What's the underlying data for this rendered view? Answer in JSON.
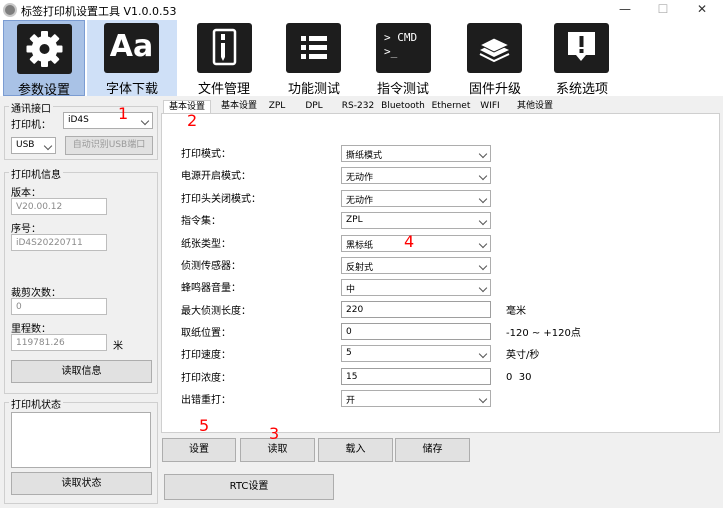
{
  "window": {
    "title": "标签打印机设置工具  V1.0.0.53",
    "minimize": "—",
    "maximize": "☐",
    "close": "✕"
  },
  "toolbar": [
    {
      "label": "参数设置",
      "icon": "gear-icon"
    },
    {
      "label": "字体下载",
      "icon": "font-aa-icon",
      "glyph": "Aa"
    },
    {
      "label": "文件管理",
      "icon": "file-manager-icon"
    },
    {
      "label": "功能测试",
      "icon": "list-icon"
    },
    {
      "label": "指令测试",
      "icon": "cmd-terminal-icon",
      "glyph_line1": "> CMD",
      "glyph_line2": ">_"
    },
    {
      "label": "固件升级",
      "icon": "chip-stack-icon"
    },
    {
      "label": "系统选项",
      "icon": "alert-box-icon"
    }
  ],
  "comm": {
    "group_label": "通讯接口",
    "printer_label": "打印机：",
    "printer_value": "iD4S",
    "port_value": "USB",
    "auto_detect_button": "自动识别USB端口"
  },
  "info": {
    "group_label": "打印机信息",
    "version_label": "版本：",
    "version_value": "V20.00.12",
    "serial_label": "序号：",
    "serial_value": "iD4S20220711",
    "cut_label": "裁剪次数：",
    "cut_value": "0",
    "mileage_label": "里程数：",
    "mileage_value": "119781.26",
    "mileage_unit": "米",
    "read_info_button": "读取信息"
  },
  "status": {
    "group_label": "打印机状态",
    "read_status_button": "读取状态"
  },
  "tabs": [
    "基本设置",
    "基本设置",
    "ZPL",
    "DPL",
    "RS-232",
    "Bluetooth",
    "Ethernet",
    "WIFI",
    "其他设置"
  ],
  "settings": [
    {
      "label": "打印模式：",
      "value": "撕纸模式",
      "kind": "combo"
    },
    {
      "label": "电源开启模式：",
      "value": "无动作",
      "kind": "combo"
    },
    {
      "label": "打印头关闭模式：",
      "value": "无动作",
      "kind": "combo"
    },
    {
      "label": "指令集：",
      "value": "ZPL",
      "kind": "combo"
    },
    {
      "label": "纸张类型：",
      "value": "黑标纸",
      "kind": "combo"
    },
    {
      "label": "侦测传感器：",
      "value": "反射式",
      "kind": "combo"
    },
    {
      "label": "蜂鸣器音量：",
      "value": "中",
      "kind": "combo"
    },
    {
      "label": "最大侦测长度：",
      "value": "220",
      "kind": "input",
      "unit": "毫米"
    },
    {
      "label": "取纸位置：",
      "value": "0",
      "kind": "input",
      "unit": "-120 ~ +120点"
    },
    {
      "label": "打印速度：",
      "value": "5",
      "kind": "combo",
      "unit": "英寸/秒"
    },
    {
      "label": "打印浓度：",
      "value": "15",
      "kind": "input",
      "unit": "0  30"
    },
    {
      "label": "出错重打：",
      "value": "开",
      "kind": "combo"
    }
  ],
  "actions": {
    "set": "设置",
    "read": "读取",
    "load": "载入",
    "save": "储存",
    "rtc": "RTC设置"
  },
  "annotations": [
    "1",
    "2",
    "3",
    "4",
    "5"
  ]
}
